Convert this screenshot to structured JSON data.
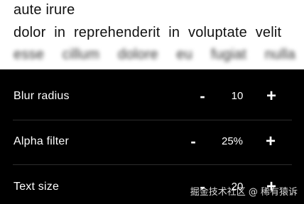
{
  "preview": {
    "lines": [
      "aute irure",
      "dolor in reprehenderit in voluptate velit",
      "esse cillum dolore eu fugiat nulla"
    ]
  },
  "controls": [
    {
      "label": "Blur radius",
      "value": "10",
      "minus": "-",
      "plus": "+"
    },
    {
      "label": "Alpha filter",
      "value": "25%",
      "minus": "-",
      "plus": "+"
    },
    {
      "label": "Text size",
      "value": "20",
      "minus": "-",
      "plus": "+"
    }
  ],
  "watermark": "掘金技术社区 @ 稀有猿诉"
}
